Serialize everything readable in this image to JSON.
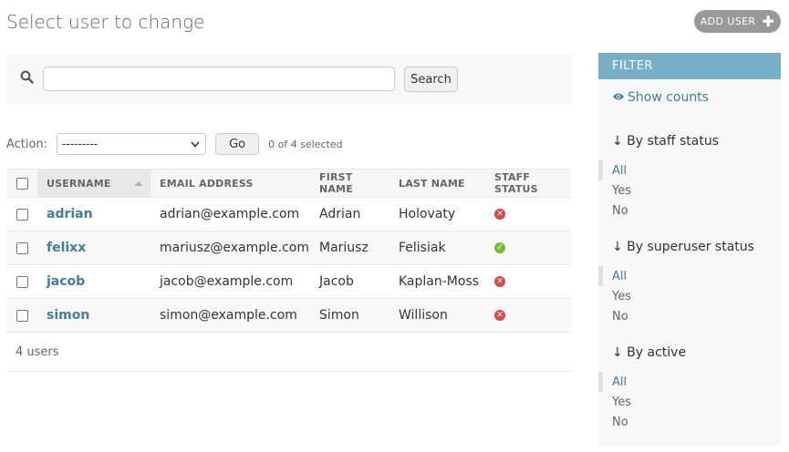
{
  "page": {
    "title": "Select user to change"
  },
  "toolbar": {
    "add_label": "ADD USER",
    "add_icon": "plus-icon"
  },
  "search": {
    "button_label": "Search",
    "value": "",
    "icon": "search-icon"
  },
  "actions": {
    "label": "Action:",
    "selected": "---------",
    "go_label": "Go",
    "selection_count": "0 of 4 selected"
  },
  "table": {
    "headers": [
      "USERNAME",
      "EMAIL ADDRESS",
      "FIRST NAME",
      "LAST NAME",
      "STAFF STATUS"
    ],
    "sorted_column": "USERNAME",
    "rows": [
      {
        "username": "adrian",
        "email": "adrian@example.com",
        "first_name": "Adrian",
        "last_name": "Holovaty",
        "staff": false
      },
      {
        "username": "felixx",
        "email": "mariusz@example.com",
        "first_name": "Mariusz",
        "last_name": "Felisiak",
        "staff": true
      },
      {
        "username": "jacob",
        "email": "jacob@example.com",
        "first_name": "Jacob",
        "last_name": "Kaplan-Moss",
        "staff": false
      },
      {
        "username": "simon",
        "email": "simon@example.com",
        "first_name": "Simon",
        "last_name": "Willison",
        "staff": false
      }
    ],
    "count_text": "4 users"
  },
  "filter": {
    "title": "FILTER",
    "show_counts": "Show counts",
    "groups": [
      {
        "title": "↓ By staff status",
        "options": [
          "All",
          "Yes",
          "No"
        ],
        "selected": "All"
      },
      {
        "title": "↓ By superuser status",
        "options": [
          "All",
          "Yes",
          "No"
        ],
        "selected": "All"
      },
      {
        "title": "↓ By active",
        "options": [
          "All",
          "Yes",
          "No"
        ],
        "selected": "All"
      }
    ]
  },
  "colors": {
    "link": "#447e9b",
    "filter_header": "#79aec8",
    "status_no": "#dd4646",
    "status_yes": "#70bf2b"
  }
}
